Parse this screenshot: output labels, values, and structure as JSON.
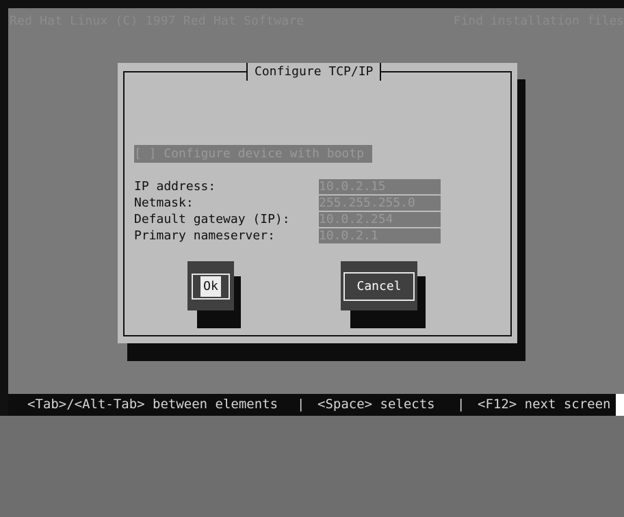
{
  "topbar": {
    "left_text": "Red Hat Linux (C) 1997 Red Hat Software",
    "right_text": "Find installation files"
  },
  "dialog": {
    "title": "Configure TCP/IP",
    "bootp_checkbox": "[ ] Configure device with bootp",
    "fields": [
      {
        "label": "IP address:",
        "value": "10.0.2.15"
      },
      {
        "label": "Netmask:",
        "value": "255.255.255.0"
      },
      {
        "label": "Default gateway (IP):",
        "value": "10.0.2.254"
      },
      {
        "label": "Primary nameserver:",
        "value": "10.0.2.1"
      }
    ],
    "ok_label": "Ok",
    "cancel_label": "Cancel"
  },
  "statusbar": {
    "part1": "<Tab>/<Alt-Tab> between elements",
    "sep1": "|",
    "part2": "<Space> selects",
    "sep2": "|",
    "part3": "<F12> next screen"
  },
  "colors": {
    "background": "#7a7a7a",
    "dialog": "#bdbdbd",
    "button": "#404040",
    "statusbar": "#0d0d0d"
  }
}
